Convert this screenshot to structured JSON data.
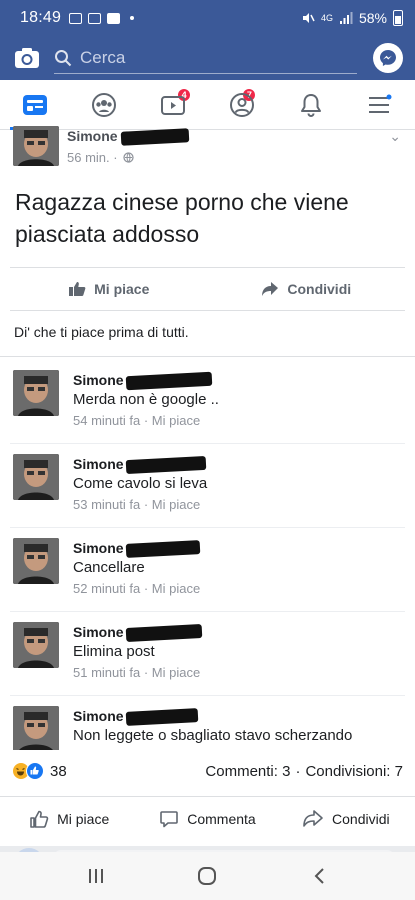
{
  "status_bar": {
    "time": "18:49",
    "network": "4G",
    "battery": "58%"
  },
  "search": {
    "placeholder": "Cerca"
  },
  "tabs": [
    {
      "name": "news-feed",
      "badge": ""
    },
    {
      "name": "groups",
      "badge": "4"
    },
    {
      "name": "watch",
      "badge": "7"
    },
    {
      "name": "profile",
      "badge": ""
    },
    {
      "name": "notifications",
      "badge": ""
    },
    {
      "name": "menu",
      "badge": ""
    }
  ],
  "post": {
    "author": "Simone",
    "time": "56 min. ·",
    "text": "Ragazza cinese porno che viene piasciata addosso",
    "like_label": "Mi piace",
    "share_label": "Condividi",
    "first_comment_prompt": "Di' che ti piace prima di tutti."
  },
  "comments": [
    {
      "name": "Simone",
      "text": "Merda non è google ..",
      "time": "54 minuti fa",
      "like": "Mi piace"
    },
    {
      "name": "Simone",
      "text": "Come cavolo si leva",
      "time": "53 minuti fa",
      "like": "Mi piace"
    },
    {
      "name": "Simone",
      "text": "Cancellare",
      "time": "52 minuti fa",
      "like": "Mi piace"
    },
    {
      "name": "Simone",
      "text": "Elimina post",
      "time": "51 minuti fa",
      "like": "Mi piace"
    },
    {
      "name": "Simone",
      "text": "Non leggete o sbagliato stavo scherzando",
      "time": "",
      "like": ""
    }
  ],
  "reactions": {
    "count": "38",
    "comments": "Commenti: 3",
    "shares": "Condivisioni: 7",
    "icons": [
      "haha-icon",
      "like-icon"
    ]
  },
  "bottom_actions": {
    "like": "Mi piace",
    "comment": "Commenta",
    "share": "Condividi"
  },
  "colors": {
    "brand": "#3b5998",
    "accent": "#1877f2",
    "badge": "#f02849"
  }
}
